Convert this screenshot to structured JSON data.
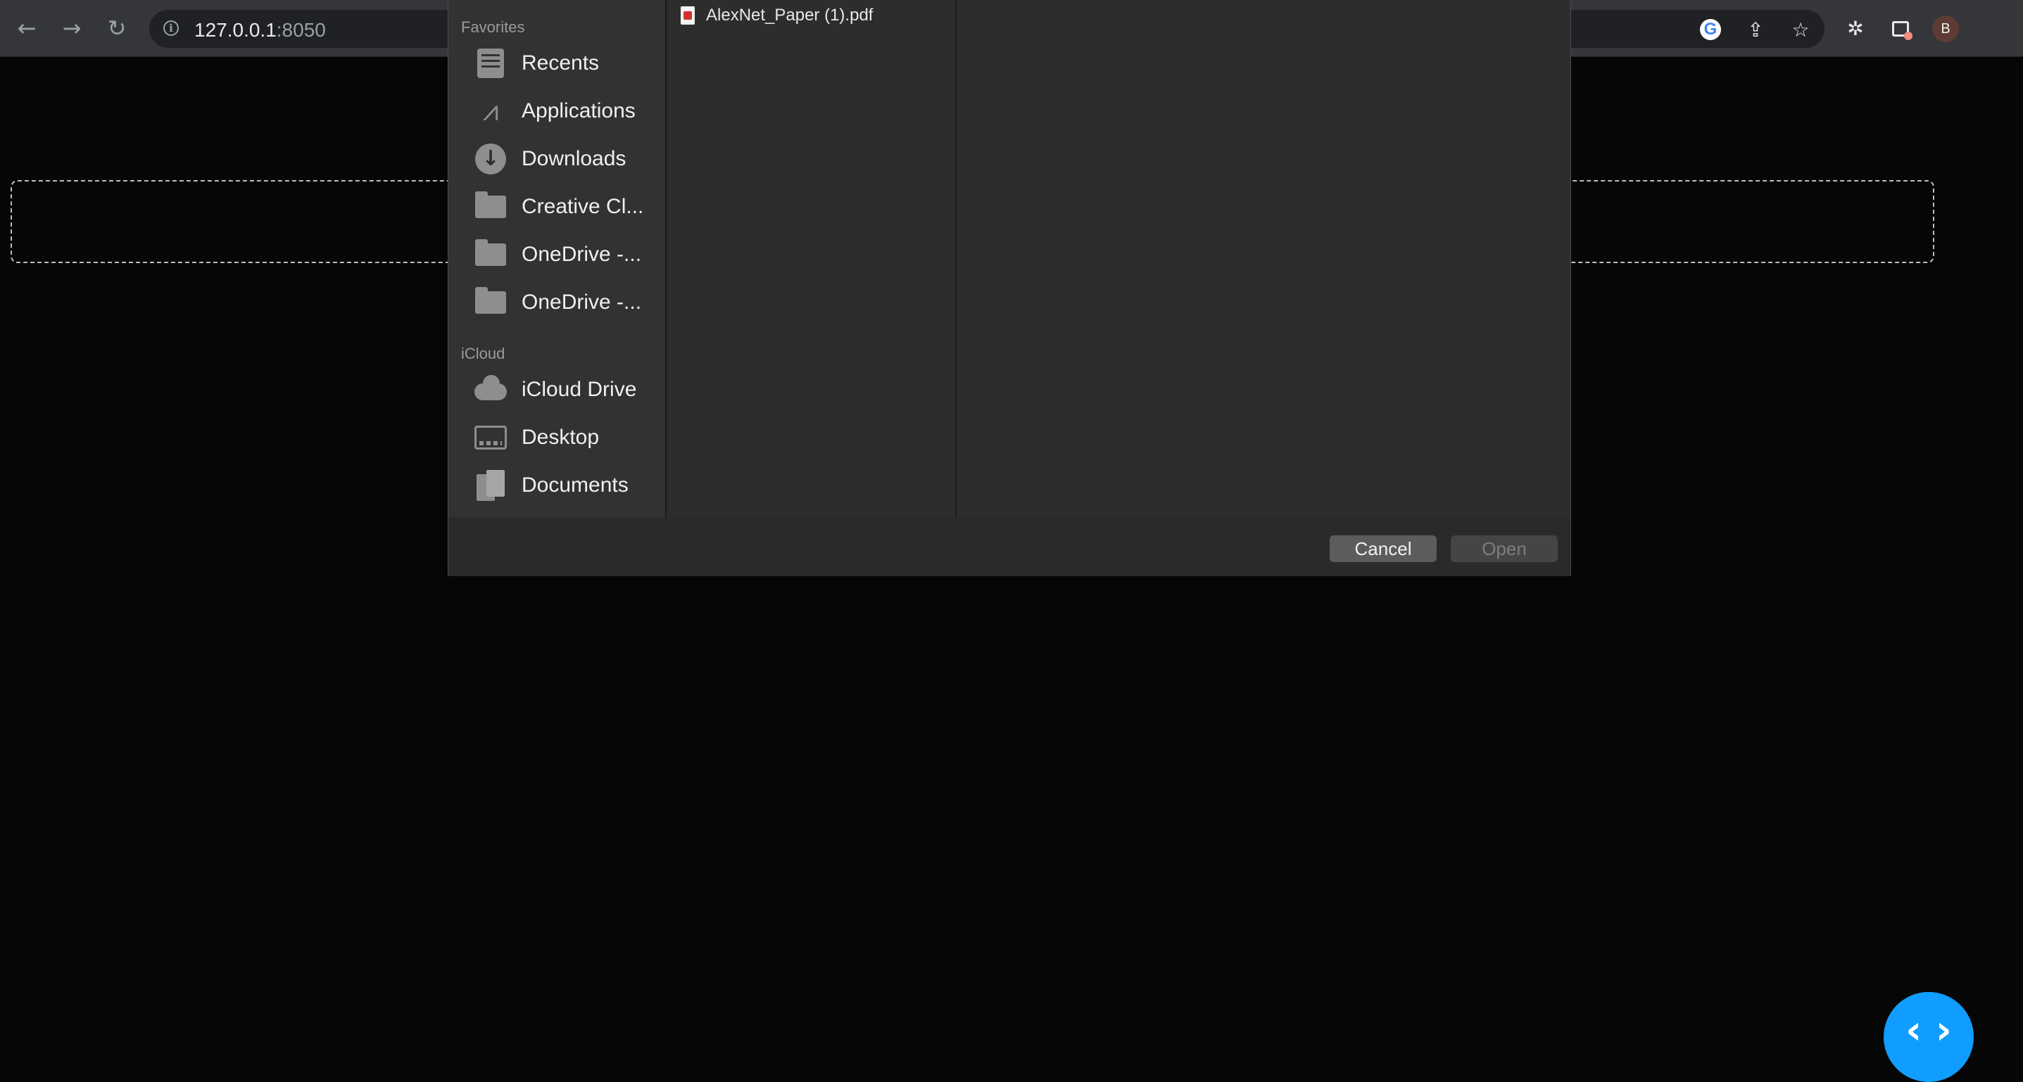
{
  "browser": {
    "url_host": "127.0.0.1",
    "url_port": ":8050",
    "profile_initial": "B",
    "icons": {
      "back": "back-arrow-icon",
      "forward": "forward-arrow-icon",
      "reload": "reload-icon",
      "site_info": "info-icon",
      "google": "google-icon",
      "share": "share-icon",
      "bookmark": "star-icon",
      "extensions": "puzzle-icon",
      "side_panel": "side-panel-icon"
    }
  },
  "dialog": {
    "sidebar": {
      "favorites_label": "Favorites",
      "favorites": [
        {
          "label": "Recents",
          "icon": "recents-icon"
        },
        {
          "label": "Applications",
          "icon": "applications-icon"
        },
        {
          "label": "Downloads",
          "icon": "downloads-icon"
        },
        {
          "label": "Creative Cl...",
          "icon": "folder-icon"
        },
        {
          "label": "OneDrive -...",
          "icon": "folder-icon"
        },
        {
          "label": "OneDrive -...",
          "icon": "folder-icon"
        }
      ],
      "icloud_label": "iCloud",
      "icloud": [
        {
          "label": "iCloud Drive",
          "icon": "cloud-icon"
        },
        {
          "label": "Desktop",
          "icon": "desktop-icon"
        },
        {
          "label": "Documents",
          "icon": "documents-icon"
        }
      ]
    },
    "files": [
      {
        "name": "AlexNet_Paper (1).pdf",
        "icon": "pdf-icon"
      }
    ],
    "buttons": {
      "cancel": "Cancel",
      "open": "Open"
    }
  },
  "page": {
    "accent_color": "#119dff",
    "fab_glyph": "‹ ›"
  }
}
